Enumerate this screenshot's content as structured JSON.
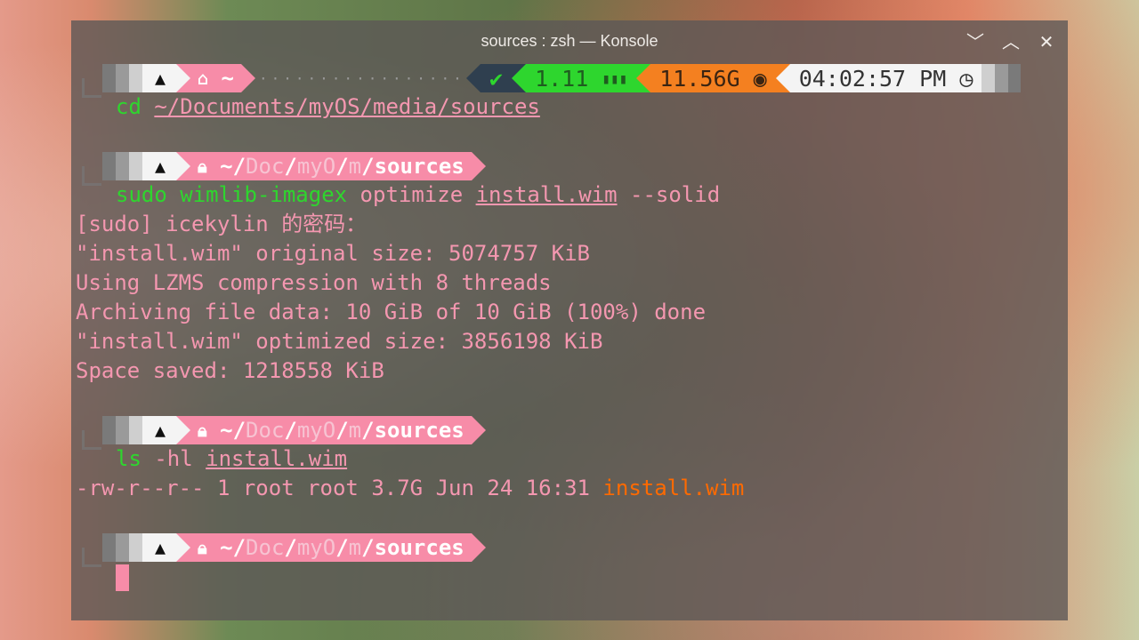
{
  "window": {
    "title": "sources : zsh — Konsole",
    "buttons": [
      "minimize",
      "maximize",
      "close"
    ]
  },
  "status": {
    "check": "✔",
    "load": "1.11",
    "memory": "11.56G",
    "time": "04:02:57 PM"
  },
  "prompts": [
    {
      "path_home": "~",
      "icon": "home-icon"
    },
    {
      "path_prefix": "~/",
      "path_dim": [
        "Doc",
        "myO",
        "m"
      ],
      "path_last": "sources",
      "icon": "lock-icon"
    }
  ],
  "commands": {
    "cmd1": {
      "name": "cd",
      "arg": "~/Documents/myOS/media/sources"
    },
    "cmd2": {
      "name": "sudo wimlib-imagex",
      "sub": " optimize ",
      "arg": "install.wim",
      "opt": " --solid"
    },
    "cmd3": {
      "name": "ls",
      "opt": " -hl ",
      "arg": "install.wim"
    }
  },
  "output": {
    "sudo_prompt": "[sudo] icekylin 的密码：",
    "orig_size": "\"install.wim\" original size: 5074757 KiB",
    "lzms": "Using LZMS compression with 8 threads",
    "archiving": "Archiving file data: 10 GiB of 10 GiB (100%) done",
    "opt_size": "\"install.wim\" optimized size: 3856198 KiB",
    "saved": "Space saved: 1218558 KiB",
    "ls_prefix": "-rw-r--r-- 1 root root 3.7G Jun 24 16:31 ",
    "ls_file": "install.wim"
  },
  "colors": {
    "accent": "#f78ca8",
    "green": "#2ed62e",
    "orange": "#ff6a00",
    "output": "#f497b0"
  }
}
